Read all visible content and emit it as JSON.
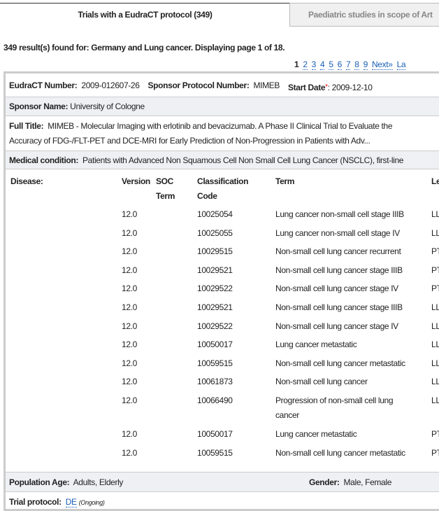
{
  "tabs": [
    {
      "label": "Trials with a EudraCT protocol (349)",
      "active": true
    },
    {
      "label": "Paediatric studies in scope of Art",
      "active": false
    }
  ],
  "summary": "349 result(s) found for: Germany and Lung cancer. Displaying page 1 of 18.",
  "pagination": {
    "current": "1",
    "pages": [
      "2",
      "3",
      "4",
      "5",
      "6",
      "7",
      "8",
      "9"
    ],
    "next": "Next»",
    "last": "La"
  },
  "trial": {
    "eudract_label": "EudraCT Number:",
    "eudract": "2009-012607-26",
    "protocol_label": "Sponsor Protocol Number:",
    "protocol": "MIMEB",
    "start_label": "Start Date",
    "start_marker": "*",
    "start": ": 2009-12-10",
    "sponsor_label": "Sponsor Name:",
    "sponsor": "University of Cologne",
    "title_label": "Full Title:",
    "title_line1": "MIMEB - Molecular Imaging with erlotinib and bevacizumab. A Phase II Clinical Trial to Evaluate the",
    "title_line2": "Accuracy of FDG-/FLT-PET and DCE-MRI for Early Prediction of Non-Progression in Patients with Adv...",
    "condition_label": "Medical condition:",
    "condition": "Patients with Advanced Non Squamous Cell Non Small Cell Lung Cancer (NSCLC), first-line",
    "disease_label": "Disease:",
    "disease_headers": {
      "version": "Version",
      "soc1": "SOC",
      "soc2": "Term",
      "class1": "Classification",
      "class2": "Code",
      "term": "Term",
      "level": "Le"
    },
    "diseases": [
      {
        "version": "12.0",
        "code": "10025054",
        "term": "Lung cancer non-small cell stage IIIB",
        "level": "LL"
      },
      {
        "version": "12.0",
        "code": "10025055",
        "term": "Lung cancer non-small cell stage IV",
        "level": "LL"
      },
      {
        "version": "12.0",
        "code": "10029515",
        "term": "Non-small cell lung cancer recurrent",
        "level": "PT"
      },
      {
        "version": "12.0",
        "code": "10029521",
        "term": "Non-small cell lung cancer stage IIIB",
        "level": "PT"
      },
      {
        "version": "12.0",
        "code": "10029522",
        "term": "Non-small cell lung cancer stage IV",
        "level": "PT"
      },
      {
        "version": "12.0",
        "code": "10029521",
        "term": "Non-small cell lung cancer stage IIIB",
        "level": "LL"
      },
      {
        "version": "12.0",
        "code": "10029522",
        "term": "Non-small cell lung cancer stage IV",
        "level": "LL"
      },
      {
        "version": "12.0",
        "code": "10050017",
        "term": "Lung cancer metastatic",
        "level": "LL"
      },
      {
        "version": "12.0",
        "code": "10059515",
        "term": "Non-small cell lung cancer metastatic",
        "level": "LL"
      },
      {
        "version": "12.0",
        "code": "10061873",
        "term": "Non-small cell lung cancer",
        "level": "LL"
      },
      {
        "version": "12.0",
        "code": "10066490",
        "term": "Progression of non-small cell lung",
        "term2": "cancer",
        "level": "LL"
      },
      {
        "version": "12.0",
        "code": "10050017",
        "term": "Lung cancer metastatic",
        "level": "PT"
      },
      {
        "version": "12.0",
        "code": "10059515",
        "term": "Non-small cell lung cancer metastatic",
        "level": "PT"
      }
    ],
    "population_label": "Population Age:",
    "population": "Adults, Elderly",
    "gender_label": "Gender:",
    "gender": "Male, Female",
    "protocol_country_label": "Trial protocol:",
    "protocol_country": "DE",
    "protocol_status": "(Ongoing)"
  }
}
